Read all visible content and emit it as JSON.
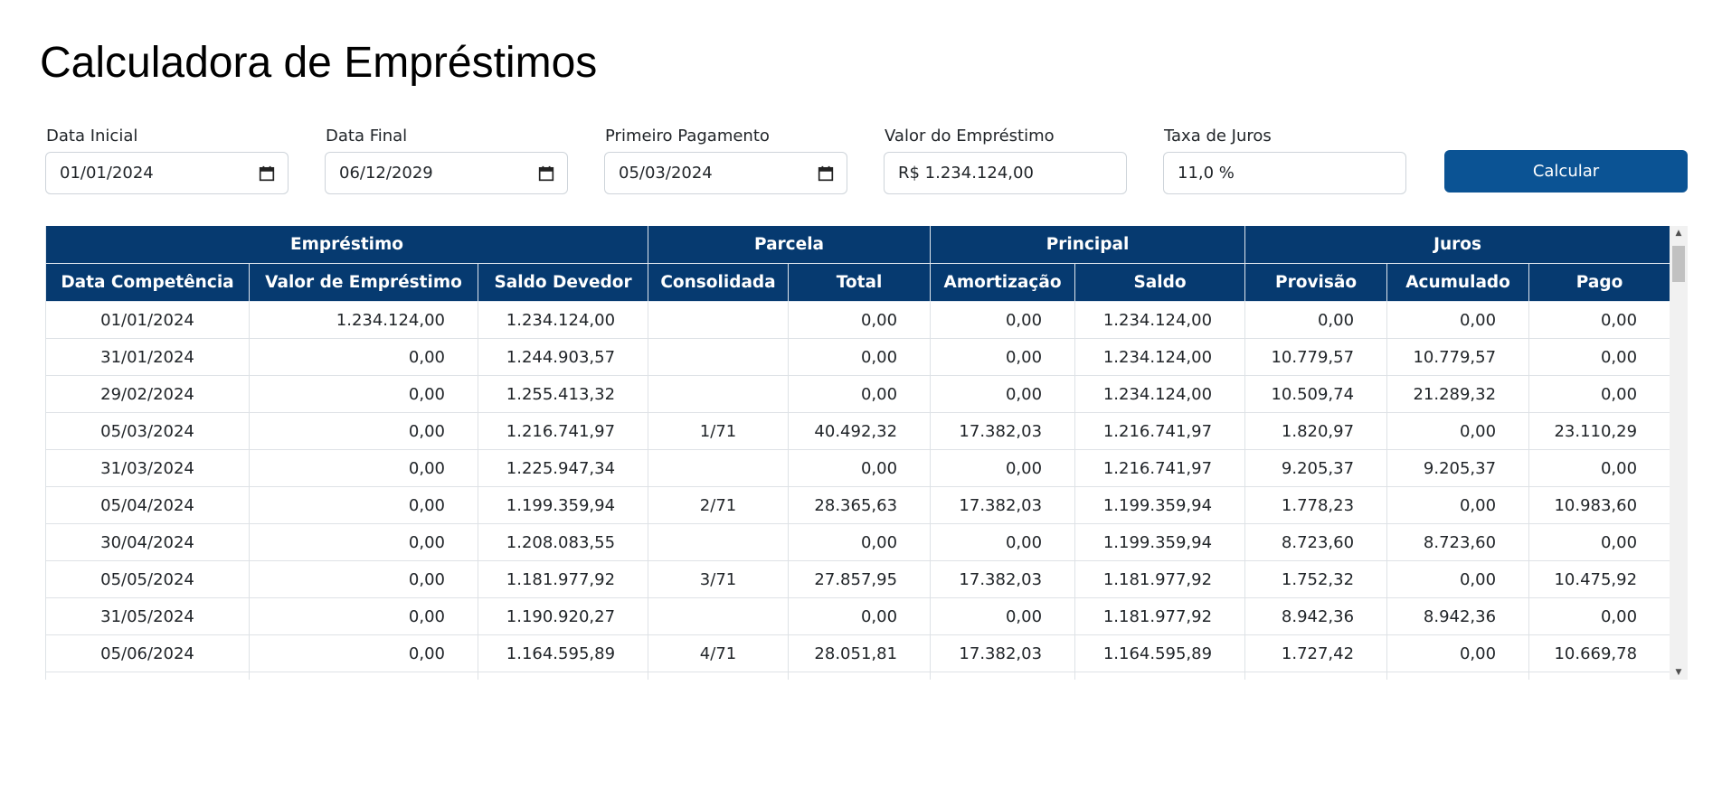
{
  "title": "Calculadora de Empréstimos",
  "form": {
    "fields": [
      {
        "label": "Data Inicial",
        "value": "01/01/2024",
        "icon": "calendar-icon"
      },
      {
        "label": "Data Final",
        "value": "06/12/2029",
        "icon": "calendar-icon"
      },
      {
        "label": "Primeiro Pagamento",
        "value": "05/03/2024",
        "icon": "calendar-icon"
      },
      {
        "label": "Valor do Empréstimo",
        "value": "R$ 1.234.124,00"
      },
      {
        "label": "Taxa de Juros",
        "value": "11,0 %"
      }
    ],
    "button_label": "Calcular"
  },
  "table": {
    "groups": [
      "Empréstimo",
      "Parcela",
      "Principal",
      "Juros"
    ],
    "columns": [
      "Data Competência",
      "Valor de Empréstimo",
      "Saldo Devedor",
      "Consolidada",
      "Total",
      "Amortização",
      "Saldo",
      "Provisão",
      "Acumulado",
      "Pago"
    ],
    "rows": [
      [
        "01/01/2024",
        "1.234.124,00",
        "1.234.124,00",
        "",
        "0,00",
        "0,00",
        "1.234.124,00",
        "0,00",
        "0,00",
        "0,00"
      ],
      [
        "31/01/2024",
        "0,00",
        "1.244.903,57",
        "",
        "0,00",
        "0,00",
        "1.234.124,00",
        "10.779,57",
        "10.779,57",
        "0,00"
      ],
      [
        "29/02/2024",
        "0,00",
        "1.255.413,32",
        "",
        "0,00",
        "0,00",
        "1.234.124,00",
        "10.509,74",
        "21.289,32",
        "0,00"
      ],
      [
        "05/03/2024",
        "0,00",
        "1.216.741,97",
        "1/71",
        "40.492,32",
        "17.382,03",
        "1.216.741,97",
        "1.820,97",
        "0,00",
        "23.110,29"
      ],
      [
        "31/03/2024",
        "0,00",
        "1.225.947,34",
        "",
        "0,00",
        "0,00",
        "1.216.741,97",
        "9.205,37",
        "9.205,37",
        "0,00"
      ],
      [
        "05/04/2024",
        "0,00",
        "1.199.359,94",
        "2/71",
        "28.365,63",
        "17.382,03",
        "1.199.359,94",
        "1.778,23",
        "0,00",
        "10.983,60"
      ],
      [
        "30/04/2024",
        "0,00",
        "1.208.083,55",
        "",
        "0,00",
        "0,00",
        "1.199.359,94",
        "8.723,60",
        "8.723,60",
        "0,00"
      ],
      [
        "05/05/2024",
        "0,00",
        "1.181.977,92",
        "3/71",
        "27.857,95",
        "17.382,03",
        "1.181.977,92",
        "1.752,32",
        "0,00",
        "10.475,92"
      ],
      [
        "31/05/2024",
        "0,00",
        "1.190.920,27",
        "",
        "0,00",
        "0,00",
        "1.181.977,92",
        "8.942,36",
        "8.942,36",
        "0,00"
      ],
      [
        "05/06/2024",
        "0,00",
        "1.164.595,89",
        "4/71",
        "28.051,81",
        "17.382,03",
        "1.164.595,89",
        "1.727,42",
        "0,00",
        "10.669,78"
      ],
      [
        "",
        "",
        "",
        "",
        "",
        "",
        "",
        "",
        "",
        ""
      ]
    ]
  },
  "colors": {
    "header_bg": "#063a70",
    "button_bg": "#0b5394"
  }
}
